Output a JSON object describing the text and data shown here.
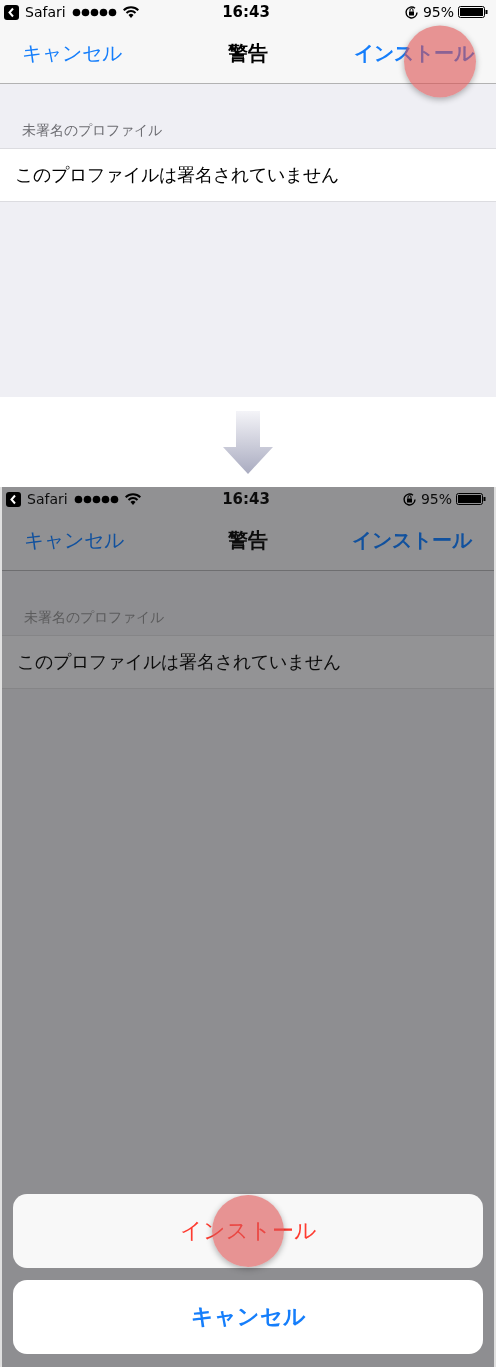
{
  "screens": [
    {
      "dimmed": false,
      "status_bar": {
        "back_app": "Safari",
        "time": "16:43",
        "battery": "95%"
      },
      "nav": {
        "left": "キャンセル",
        "title": "警告",
        "right": "インストール",
        "right_tapped": true
      },
      "section_header": "未署名のプロファイル",
      "row": "このプロファイルは署名されていません"
    },
    {
      "dimmed": true,
      "status_bar": {
        "back_app": "Safari",
        "time": "16:43",
        "battery": "95%"
      },
      "nav": {
        "left": "キャンセル",
        "title": "警告",
        "right": "インストール",
        "right_tapped": false
      },
      "section_header": "未署名のプロファイル",
      "row": "このプロファイルは署名されていません",
      "action_sheet": [
        {
          "label": "インストール",
          "kind": "destructive",
          "tapped": true
        },
        {
          "label": "キャンセル",
          "kind": "cancel",
          "tapped": false
        }
      ]
    }
  ]
}
